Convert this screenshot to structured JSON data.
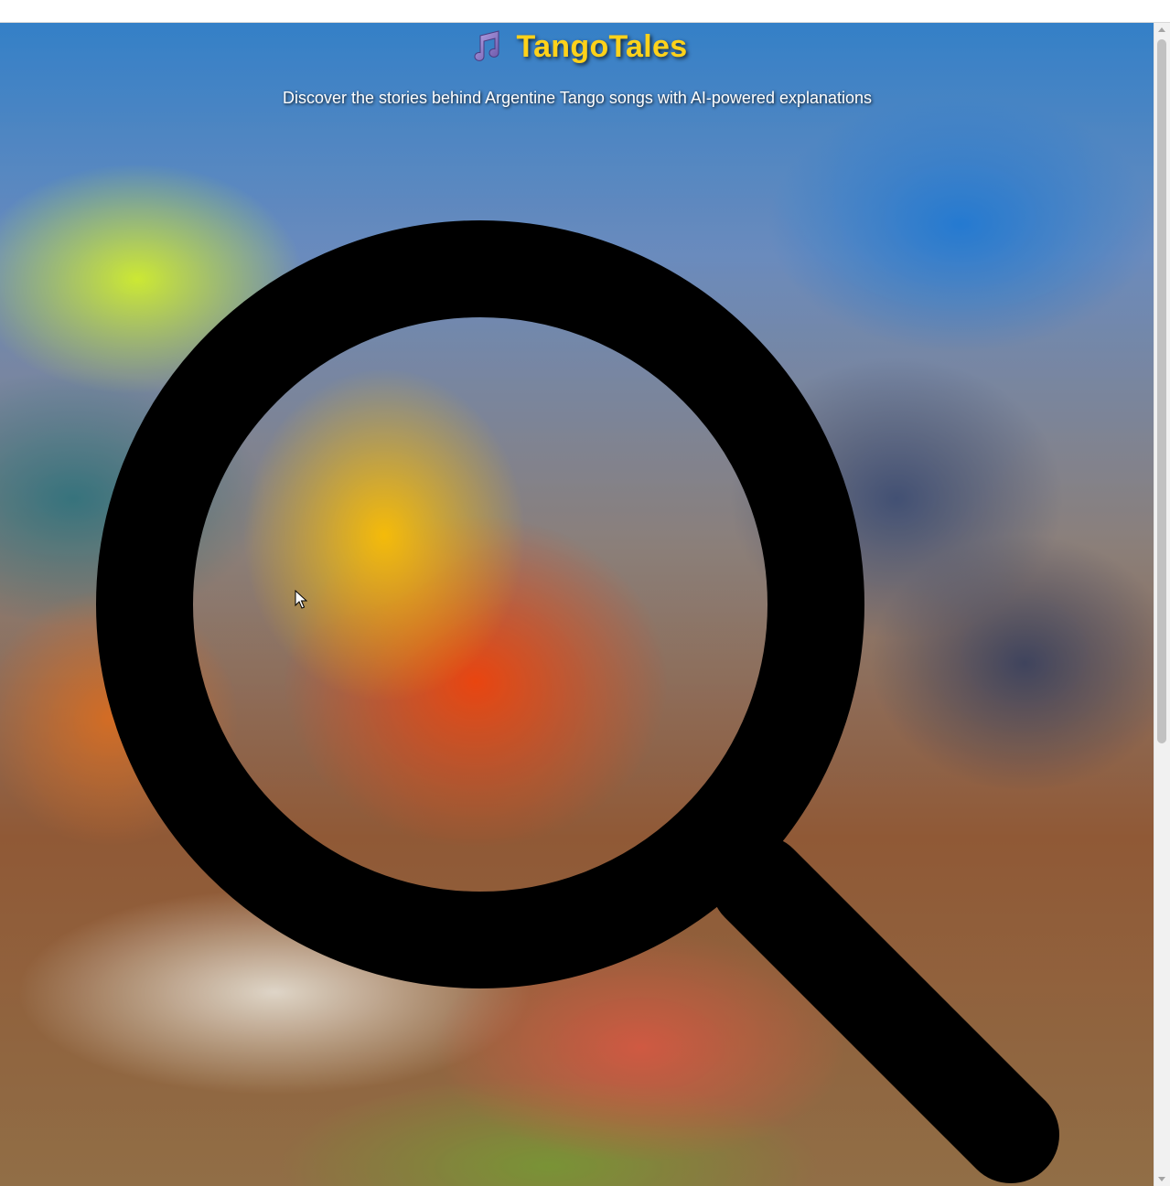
{
  "header": {
    "title": "TangoTales",
    "subtitle": "Discover the stories behind Argentine Tango songs with AI-powered explanations",
    "title_color": "#ffd21a"
  },
  "icons": {
    "title_icon": "music-note-icon",
    "main_graphic": "magnifying-glass-icon"
  },
  "colors": {
    "note_icon": "#8e7cc3"
  }
}
